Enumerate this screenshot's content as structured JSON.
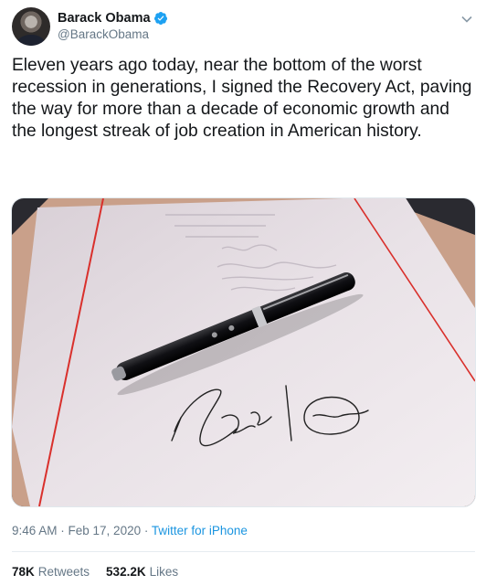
{
  "user": {
    "display_name": "Barack Obama",
    "handle": "@BarackObama",
    "verified": true,
    "avatar_icon": "avatar-photo"
  },
  "tweet": {
    "text": "Eleven years ago today, near the bottom of the worst recession in generations, I signed the Recovery Act, paving the way for more than a decade of economic growth and the longest streak of job creation in American history."
  },
  "media": {
    "description_icon": "photo-pen-signature"
  },
  "meta": {
    "timestamp": "9:46 AM · Feb 17, 2020 · ",
    "source": "Twitter for iPhone"
  },
  "stats": {
    "retweets_count": "78K",
    "retweets_label": "Retweets",
    "likes_count": "532.2K",
    "likes_label": "Likes"
  },
  "colors": {
    "text": "#14171a",
    "muted": "#657786",
    "link": "#1b95e0",
    "verified": "#1da1f2"
  }
}
